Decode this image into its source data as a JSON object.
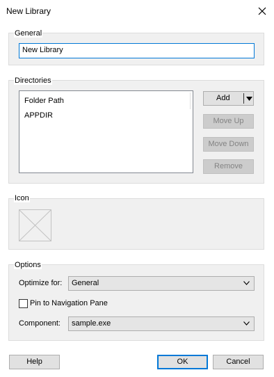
{
  "window": {
    "title": "New Library"
  },
  "general": {
    "label": "General",
    "name_value": "New Library"
  },
  "directories": {
    "label": "Directories",
    "items": [
      "Folder Path",
      "APPDIR"
    ],
    "add_label": "Add",
    "move_up_label": "Move Up",
    "move_down_label": "Move Down",
    "remove_label": "Remove"
  },
  "icon_section": {
    "label": "Icon"
  },
  "options": {
    "label": "Options",
    "optimize_label": "Optimize for:",
    "optimize_value": "General",
    "pin_label": "Pin to Navigation Pane",
    "pin_checked": false,
    "component_label": "Component:",
    "component_value": "sample.exe"
  },
  "footer": {
    "help_label": "Help",
    "ok_label": "OK",
    "cancel_label": "Cancel"
  },
  "icons": {
    "close": "close-icon",
    "dropdown": "chevron-down-icon",
    "placeholder": "image-placeholder-icon"
  }
}
